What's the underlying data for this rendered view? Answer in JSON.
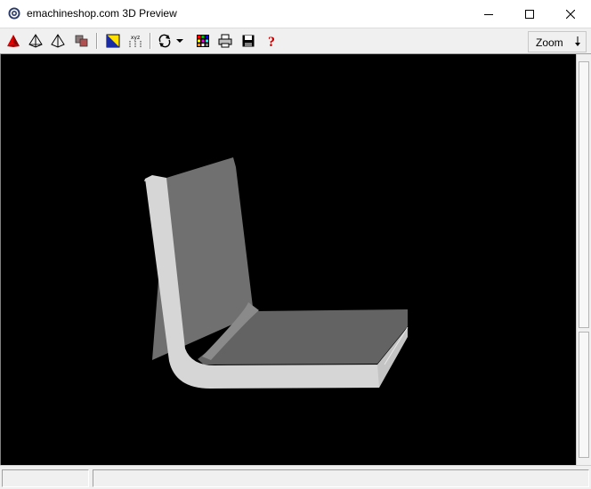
{
  "window": {
    "title": "emachineshop.com 3D Preview",
    "app_icon": "emachineshop-gear-icon",
    "controls": {
      "minimize_icon": "minimize-icon",
      "maximize_icon": "maximize-icon",
      "close_icon": "close-icon"
    }
  },
  "toolbar": {
    "buttons": [
      {
        "name": "solid-view-icon",
        "tooltip": ""
      },
      {
        "name": "wireframe-view-icon",
        "tooltip": ""
      },
      {
        "name": "hidden-line-view-icon",
        "tooltip": ""
      },
      {
        "name": "multi-part-view-icon",
        "tooltip": ""
      },
      {
        "name": "color-edges-icon",
        "tooltip": ""
      },
      {
        "name": "xyz-axes-icon",
        "tooltip": ""
      },
      {
        "name": "rotate-icon",
        "tooltip": ""
      },
      {
        "name": "rotate-dropdown-icon",
        "tooltip": ""
      },
      {
        "name": "color-palette-icon",
        "tooltip": ""
      },
      {
        "name": "print-icon",
        "tooltip": ""
      },
      {
        "name": "save-icon",
        "tooltip": ""
      },
      {
        "name": "help-icon",
        "tooltip": ""
      }
    ],
    "axes_label": "xyz",
    "help_label": "?",
    "zoom": {
      "label": "Zoom",
      "arrow_icon": "down-arrow-icon"
    }
  },
  "viewport": {
    "background": "#000000",
    "part_face_color": "#6e6e6e",
    "part_edge_color": "#d4d4d4",
    "model": "bent-sheet-metal-l-bracket"
  },
  "statusbar": {
    "pane1": "",
    "pane2": ""
  },
  "colors": {
    "accent_red": "#cc0000",
    "help_red": "#c00000",
    "chrome": "#f0f0f0"
  }
}
